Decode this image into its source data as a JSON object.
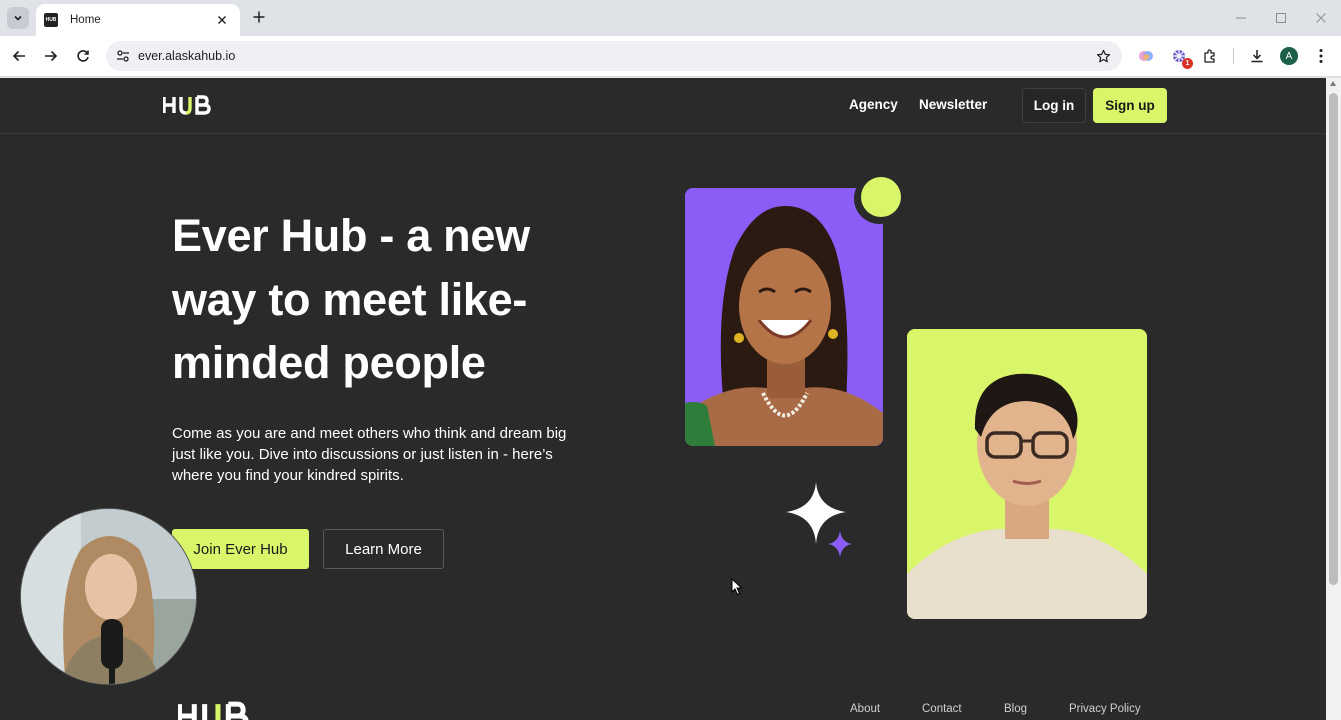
{
  "browser": {
    "tab_title": "Home",
    "favicon_text": "HUB",
    "url": "ever.alaskahub.io",
    "extension_badge": "1",
    "profile_initial": "A"
  },
  "site": {
    "logo_text": "HUB",
    "nav": {
      "agency": "Agency",
      "newsletter": "Newsletter",
      "login": "Log in",
      "signup": "Sign up"
    },
    "hero": {
      "title": "Ever Hub - a new way to meet like-minded people",
      "subtitle": "Come as you are and meet others who think and dream big just like you. Dive into discussions or just listen in - here’s where you find your kindred spirits.",
      "primary_cta": "Join Ever Hub",
      "secondary_cta": "Learn More"
    },
    "footer": {
      "logo_text": "HUB",
      "links": [
        "About",
        "Contact",
        "Blog",
        "Privacy Policy"
      ]
    }
  },
  "colors": {
    "accent": "#d9f56a",
    "purple": "#8b5cf6",
    "page_bg": "#2a2a2a"
  },
  "icons": {
    "tab_list": "chevron-down-icon",
    "close": "close-icon",
    "new_tab": "plus-icon",
    "back": "arrow-left-icon",
    "forward": "arrow-right-icon",
    "reload": "reload-icon",
    "site_info": "tune-icon",
    "bookmark": "star-icon",
    "extensions": "puzzle-icon",
    "download": "download-icon",
    "menu": "kebab-menu-icon"
  }
}
